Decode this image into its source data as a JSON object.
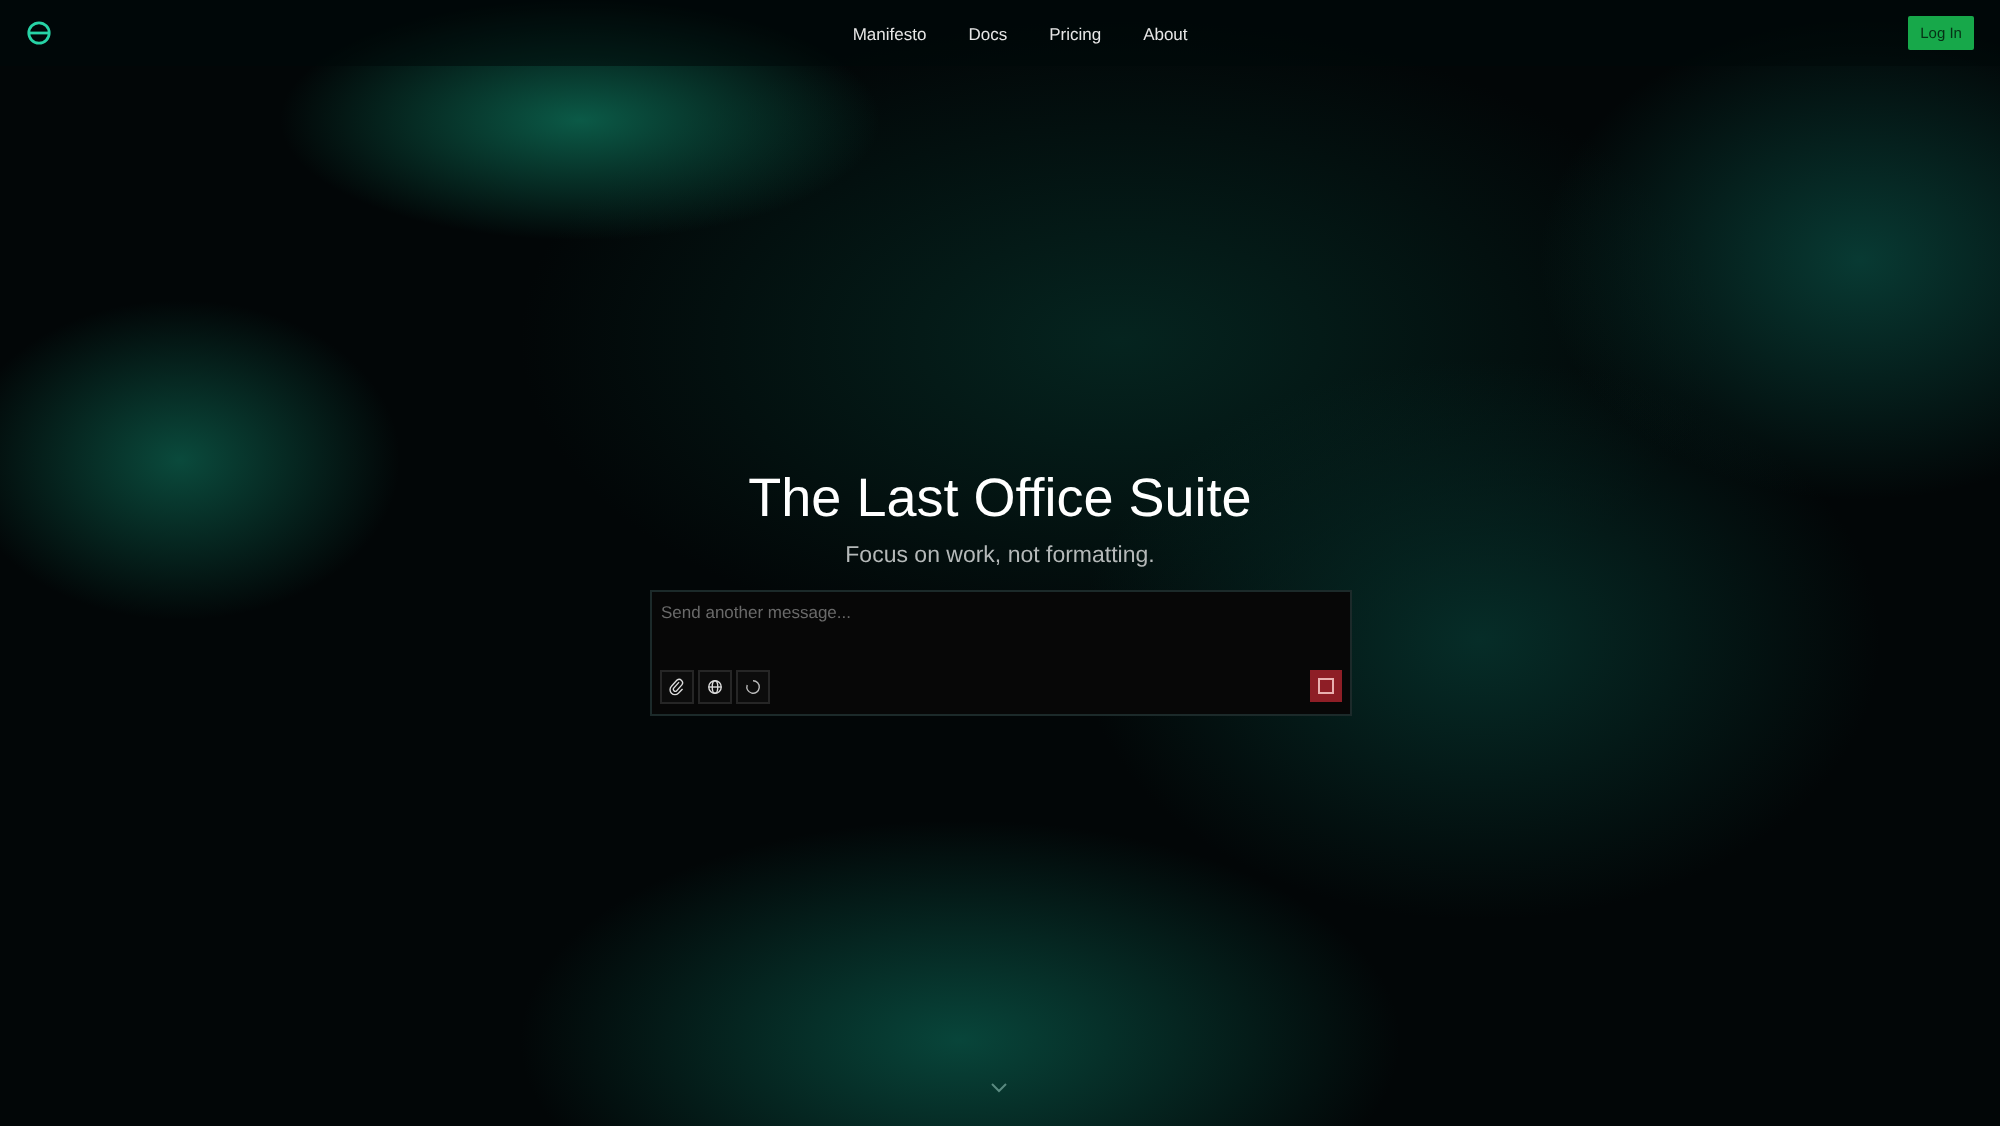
{
  "nav": {
    "links": [
      {
        "label": "Manifesto"
      },
      {
        "label": "Docs"
      },
      {
        "label": "Pricing"
      },
      {
        "label": "About"
      }
    ],
    "login_button": "Log In"
  },
  "hero": {
    "title": "The Last Office Suite",
    "subtitle": "Focus on work, not formatting."
  },
  "composer": {
    "placeholder": "Send another message...",
    "tools": [
      {
        "kind": "attach"
      },
      {
        "kind": "web"
      },
      {
        "kind": "loading"
      }
    ],
    "generating": true
  }
}
